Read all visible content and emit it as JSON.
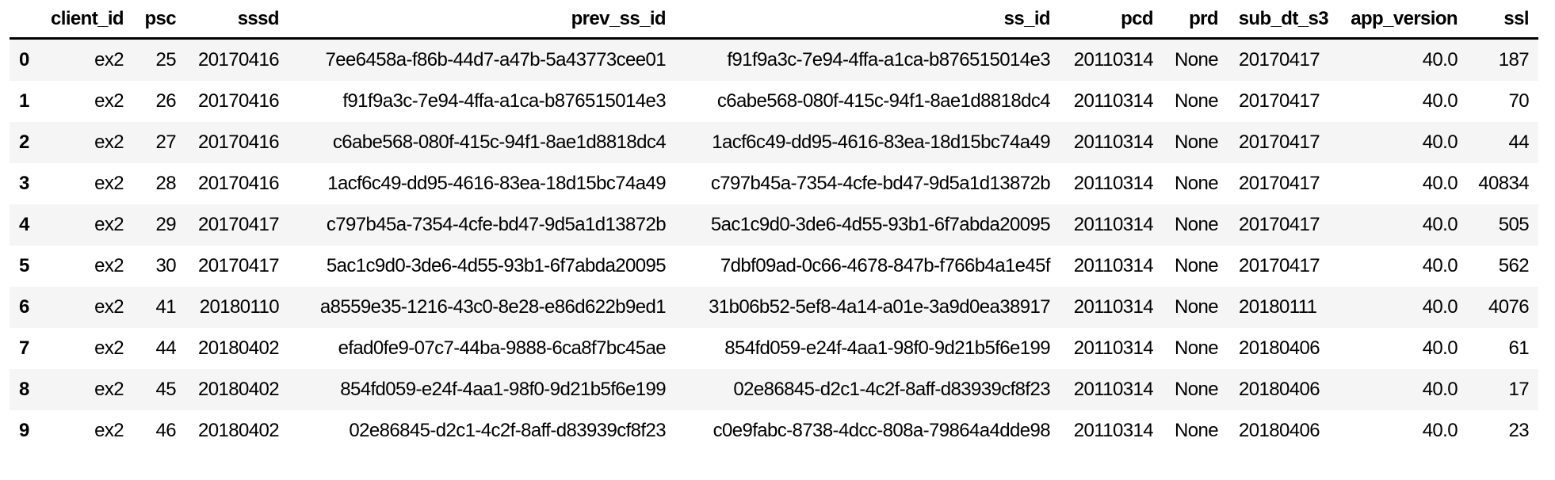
{
  "columns": [
    "",
    "client_id",
    "psc",
    "sssd",
    "prev_ss_id",
    "ss_id",
    "pcd",
    "prd",
    "sub_dt_s3",
    "app_version",
    "ssl"
  ],
  "rows": [
    [
      "0",
      "ex2",
      "25",
      "20170416",
      "7ee6458a-f86b-44d7-a47b-5a43773cee01",
      "f91f9a3c-7e94-4ffa-a1ca-b876515014e3",
      "20110314",
      "None",
      "20170417",
      "40.0",
      "187"
    ],
    [
      "1",
      "ex2",
      "26",
      "20170416",
      "f91f9a3c-7e94-4ffa-a1ca-b876515014e3",
      "c6abe568-080f-415c-94f1-8ae1d8818dc4",
      "20110314",
      "None",
      "20170417",
      "40.0",
      "70"
    ],
    [
      "2",
      "ex2",
      "27",
      "20170416",
      "c6abe568-080f-415c-94f1-8ae1d8818dc4",
      "1acf6c49-dd95-4616-83ea-18d15bc74a49",
      "20110314",
      "None",
      "20170417",
      "40.0",
      "44"
    ],
    [
      "3",
      "ex2",
      "28",
      "20170416",
      "1acf6c49-dd95-4616-83ea-18d15bc74a49",
      "c797b45a-7354-4cfe-bd47-9d5a1d13872b",
      "20110314",
      "None",
      "20170417",
      "40.0",
      "40834"
    ],
    [
      "4",
      "ex2",
      "29",
      "20170417",
      "c797b45a-7354-4cfe-bd47-9d5a1d13872b",
      "5ac1c9d0-3de6-4d55-93b1-6f7abda20095",
      "20110314",
      "None",
      "20170417",
      "40.0",
      "505"
    ],
    [
      "5",
      "ex2",
      "30",
      "20170417",
      "5ac1c9d0-3de6-4d55-93b1-6f7abda20095",
      "7dbf09ad-0c66-4678-847b-f766b4a1e45f",
      "20110314",
      "None",
      "20170417",
      "40.0",
      "562"
    ],
    [
      "6",
      "ex2",
      "41",
      "20180110",
      "a8559e35-1216-43c0-8e28-e86d622b9ed1",
      "31b06b52-5ef8-4a14-a01e-3a9d0ea38917",
      "20110314",
      "None",
      "20180111",
      "40.0",
      "4076"
    ],
    [
      "7",
      "ex2",
      "44",
      "20180402",
      "efad0fe9-07c7-44ba-9888-6ca8f7bc45ae",
      "854fd059-e24f-4aa1-98f0-9d21b5f6e199",
      "20110314",
      "None",
      "20180406",
      "40.0",
      "61"
    ],
    [
      "8",
      "ex2",
      "45",
      "20180402",
      "854fd059-e24f-4aa1-98f0-9d21b5f6e199",
      "02e86845-d2c1-4c2f-8aff-d83939cf8f23",
      "20110314",
      "None",
      "20180406",
      "40.0",
      "17"
    ],
    [
      "9",
      "ex2",
      "46",
      "20180402",
      "02e86845-d2c1-4c2f-8aff-d83939cf8f23",
      "c0e9fabc-8738-4dcc-808a-79864a4dde98",
      "20110314",
      "None",
      "20180406",
      "40.0",
      "23"
    ]
  ]
}
